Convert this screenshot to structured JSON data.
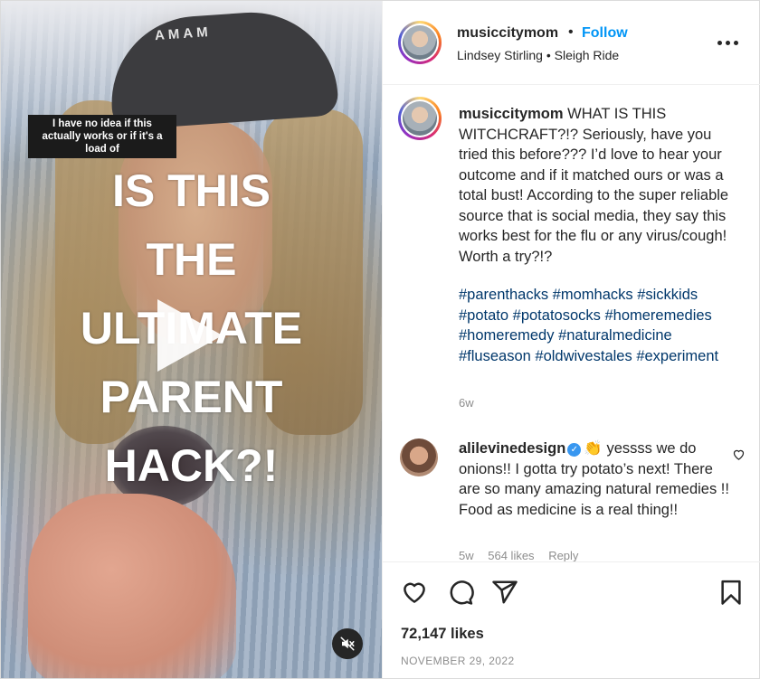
{
  "video": {
    "cap_brand": "AMAM",
    "subtitle": "I have no idea if this actually works or if it's a load of",
    "headline_lines": [
      "IS THIS",
      "THE",
      "ULTIMATE",
      "PARENT",
      "HACK?!"
    ],
    "play_icon": "play-icon",
    "mute_icon": "mute-icon"
  },
  "header": {
    "username": "musiccitymom",
    "separator": "•",
    "follow_label": "Follow",
    "audio": "Lindsey Stirling • Sleigh Ride",
    "more_icon": "more-options-icon"
  },
  "caption": {
    "username": "musiccitymom",
    "text": "WHAT IS THIS WITCHCRAFT?!? Seriously, have you tried this before??? I’d love to hear your outcome and if it matched ours or was a total bust! According to the super reliable source that is social media, they say this works best for the flu or any virus/cough! Worth a try?!?",
    "hashtags": [
      "#parenthacks",
      "#momhacks",
      "#sickkids",
      "#potato",
      "#potatosocks",
      "#homeremedies",
      "#homeremedy",
      "#naturalmedicine",
      "#fluseason",
      "#oldwivestales",
      "#experiment"
    ],
    "time": "6w"
  },
  "comment": {
    "username": "alilevinedesign",
    "emoji": "👏",
    "text": "yessss we do onions!! I gotta try potato’s next! There are so many amazing natural remedies !! Food as medicine is a real thing!!",
    "meta_time": "5w",
    "meta_likes": "564 likes",
    "meta_reply": "Reply"
  },
  "actions": {
    "likes": "72,147 likes",
    "date": "NOVEMBER 29, 2022"
  },
  "colors": {
    "follow_blue": "#0095f6",
    "hashtag": "#00376b",
    "muted_text": "#8e8e8e",
    "verified": "#3897f0"
  }
}
